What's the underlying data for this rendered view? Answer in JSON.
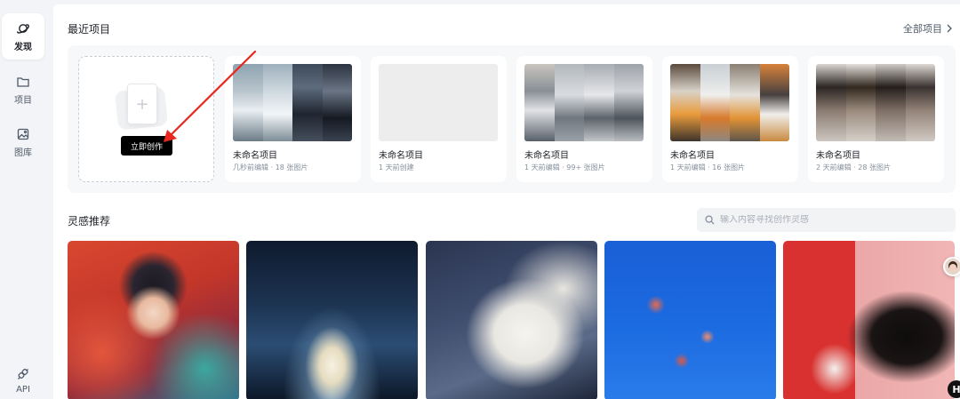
{
  "sidebar": {
    "items": [
      {
        "label": "发现",
        "icon": "planet-icon"
      },
      {
        "label": "项目",
        "icon": "folder-icon"
      },
      {
        "label": "图库",
        "icon": "image-icon"
      }
    ],
    "api_label": "API"
  },
  "recent": {
    "title": "最近项目",
    "all_label": "全部项目",
    "create_label": "立即创作",
    "projects": [
      {
        "name": "未命名项目",
        "meta": "几秒前编辑 · 18 张图片"
      },
      {
        "name": "未命名项目",
        "meta": "1 天前创建"
      },
      {
        "name": "未命名项目",
        "meta": "1 天前编辑 · 99+ 张图片"
      },
      {
        "name": "未命名项目",
        "meta": "1 天前编辑 · 16 张图片"
      },
      {
        "name": "未命名项目",
        "meta": "2 天前编辑 · 28 张图片"
      }
    ]
  },
  "inspiration": {
    "title": "灵感推荐",
    "search_placeholder": "输入内容寻找创作灵感"
  },
  "float": {
    "help_label": "H"
  },
  "colors": {
    "accent": "#000000",
    "annotation_arrow": "#e8281e",
    "page_bg": "#f3f4f7"
  }
}
